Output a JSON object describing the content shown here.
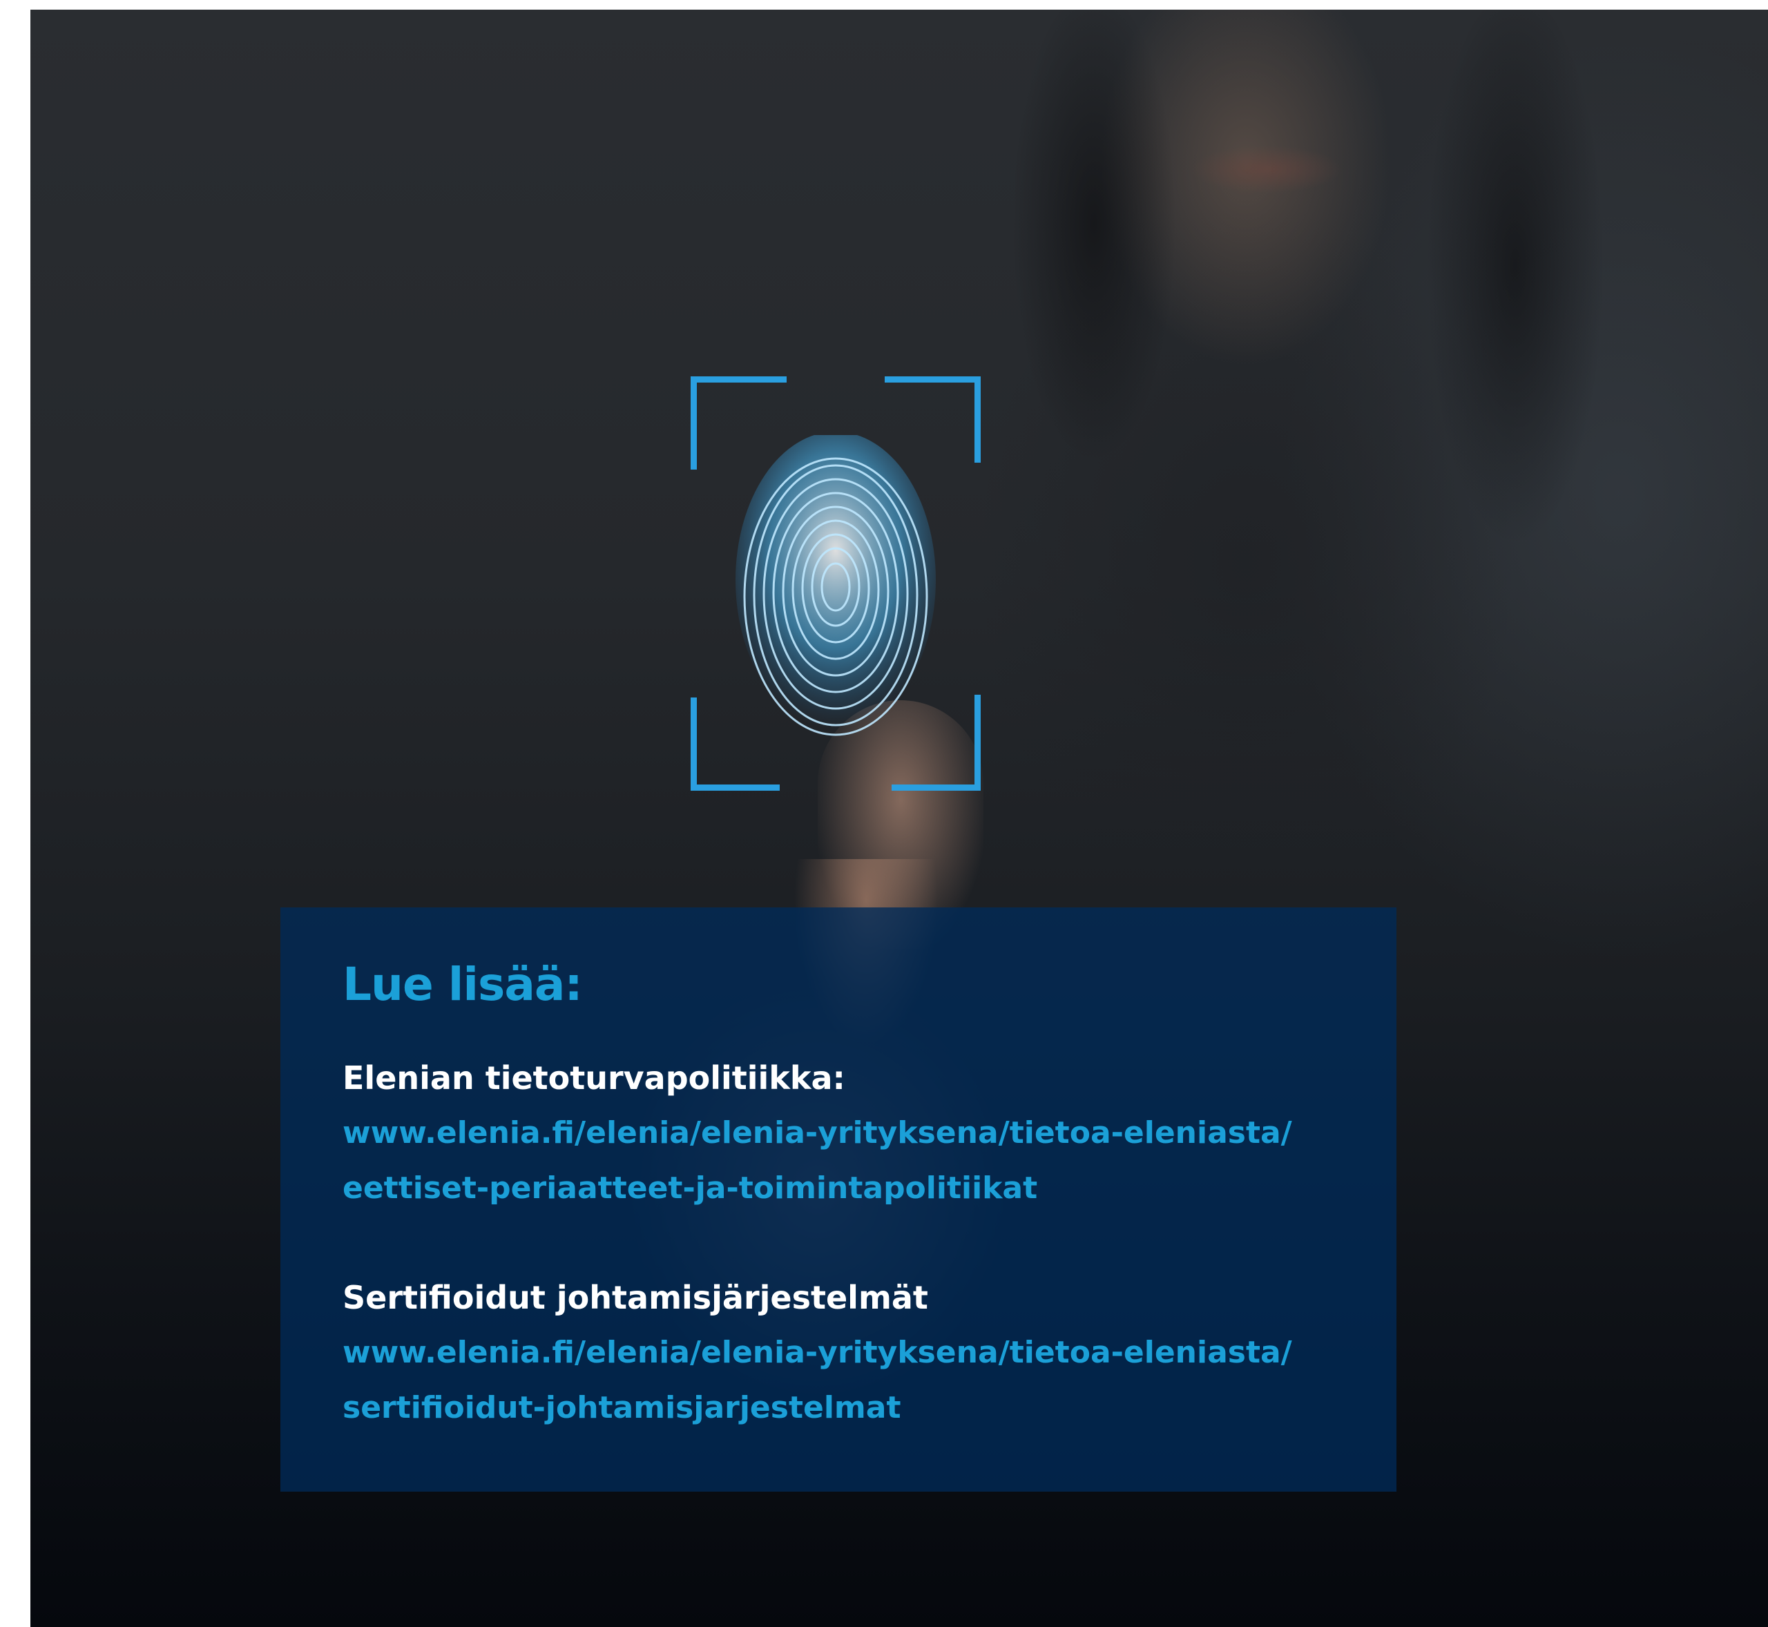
{
  "info": {
    "heading": "Lue lisää:",
    "sections": [
      {
        "title": "Elenian tietoturvapolitiikka:",
        "link_lines": [
          "www.elenia.fi/elenia/elenia-yrityksena/tietoa-eleniasta/",
          "eettiset-periaatteet-ja-toimintapolitiikat"
        ]
      },
      {
        "title": "Sertifioidut johtamisjärjestelmät",
        "link_lines": [
          "www.elenia.fi/elenia/elenia-yrityksena/tietoa-eleniasta/",
          "sertifioidut-johtamisjarjestelmat"
        ]
      }
    ]
  },
  "colors": {
    "accent": "#1ba0d8",
    "box_background": "#002a58",
    "title_text": "#ffffff",
    "scan_glow": "#2a9fe0"
  },
  "icons": {
    "scan_frame": "scan-frame-icon",
    "fingerprint": "fingerprint-icon"
  }
}
